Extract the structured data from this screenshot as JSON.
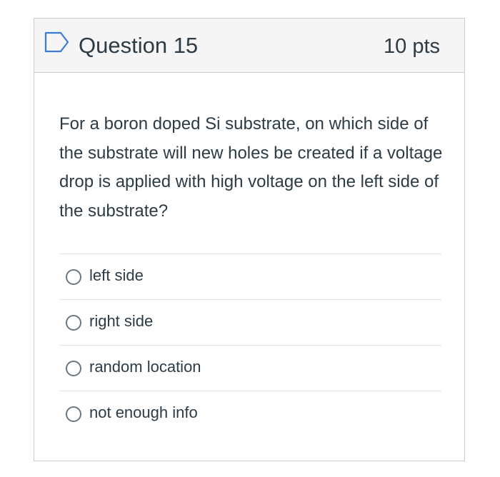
{
  "question": {
    "title": "Question 15",
    "points": "10 pts",
    "text": "For a boron doped Si substrate, on which side of the substrate will new holes be created if a voltage drop is applied with high voltage on the left side of the substrate?"
  },
  "answers": [
    {
      "label": "left side"
    },
    {
      "label": "right side"
    },
    {
      "label": "random location"
    },
    {
      "label": "not enough info"
    }
  ],
  "icons": {
    "flag": "flag-outline-icon",
    "radio": "radio-unchecked-icon"
  },
  "colors": {
    "text": "#2d3b45",
    "flag": "#3a7bd5",
    "header_bg": "#f5f5f5",
    "border": "#c7cdd1"
  }
}
